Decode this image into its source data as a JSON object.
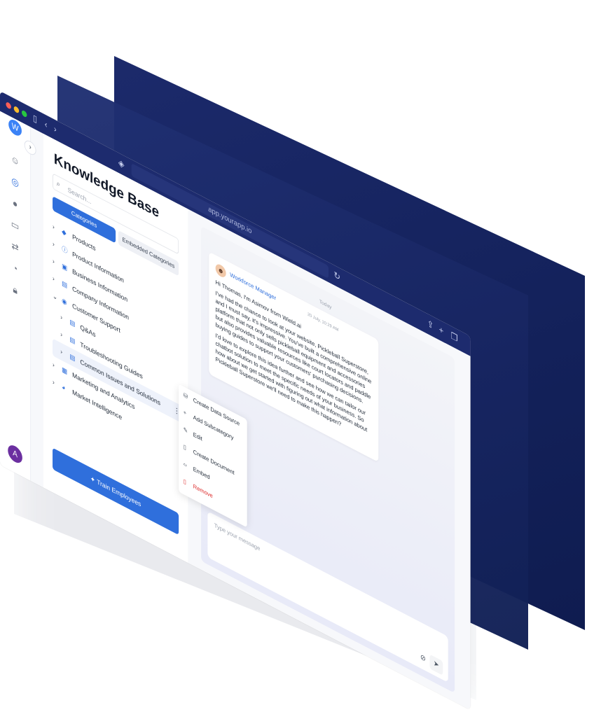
{
  "browser": {
    "url": "app.yourapp.io"
  },
  "rail": {
    "logo": "W",
    "avatar_initial": "A",
    "icons": [
      "bot-icon",
      "knowledge-icon",
      "chat-icon",
      "inbox-icon",
      "translate-icon",
      "analytics-icon",
      "lock-icon"
    ]
  },
  "sidebar": {
    "title": "Knowledge Base",
    "search_placeholder": "Search...",
    "tab_categories": "Categories",
    "tab_embedded": "Embedded Categories",
    "items": [
      {
        "label": "Products",
        "icon": "cube-icon",
        "level": 0
      },
      {
        "label": "Product Information",
        "icon": "info-icon",
        "level": 0
      },
      {
        "label": "Business Information",
        "icon": "briefcase-icon",
        "level": 0
      },
      {
        "label": "Company Information",
        "icon": "document-icon",
        "level": 0
      },
      {
        "label": "Customer Support",
        "icon": "support-icon",
        "level": 0
      },
      {
        "label": "Q&As",
        "icon": "document-icon",
        "level": 1
      },
      {
        "label": "Troubleshooting Guides",
        "icon": "document-icon",
        "level": 1
      },
      {
        "label": "Common Issues and Solutions",
        "icon": "document-icon",
        "level": 1
      },
      {
        "label": "Marketing and Analytics",
        "icon": "chart-icon",
        "level": 0
      },
      {
        "label": "Market Intelligence",
        "icon": "pie-icon",
        "level": 0
      }
    ],
    "train_button": "Train Employees"
  },
  "context_menu": {
    "items": [
      {
        "label": "Create Data Source",
        "icon": "database-icon"
      },
      {
        "label": "Add Subcategory",
        "icon": "plus-icon"
      },
      {
        "label": "Edit",
        "icon": "pencil-icon"
      },
      {
        "label": "Create Document",
        "icon": "file-plus-icon"
      },
      {
        "label": "Embed",
        "icon": "code-icon"
      },
      {
        "label": "Remove",
        "icon": "trash-icon"
      }
    ]
  },
  "chat": {
    "day_label": "Today",
    "agent_name": "Workforce Manager",
    "timestamp": "20 July, 10:29 AM",
    "message_paragraphs": [
      "Hi Thomas, I'm Asimov from Wield.ai",
      "I've had the chance to look at your website, Pickleball Superstore, and I must say, it's impressive. You've built a comprehensive online platform that not only sells pickleball equipment and accessories but also provides valuable resources like court locators and paddle buying guides to support your customers' purchasing decisions.",
      "I'd love to explore this idea further and see how we can tailor our chatbot solution to meet the specific needs of your business. So how about we get started with figuring out what information about Pickleball Superstore we'll need to make this happen?"
    ],
    "composer_placeholder": "Type your message"
  },
  "colors": {
    "accent": "#2f6fdc",
    "navy": "#1d2b6e",
    "danger": "#dc2626"
  }
}
